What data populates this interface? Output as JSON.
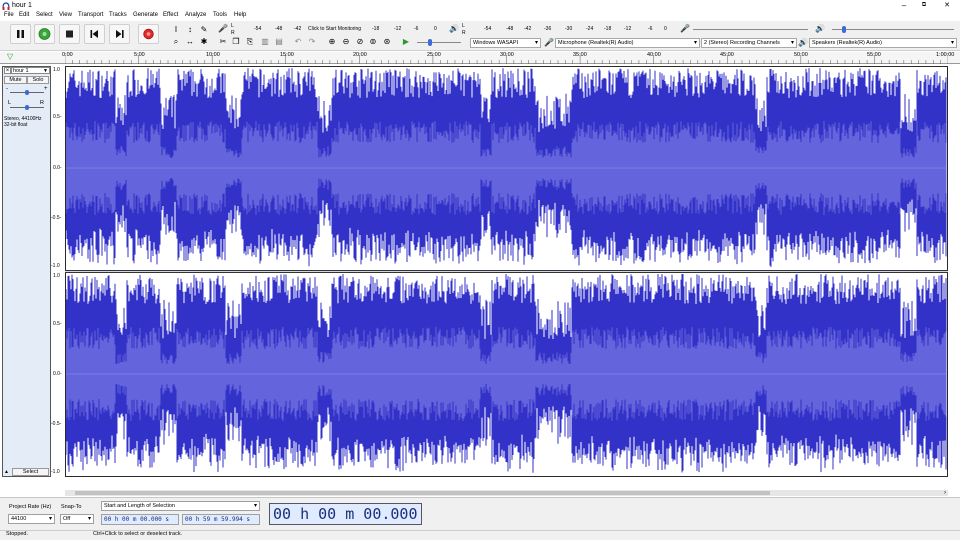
{
  "window": {
    "title": "hour 1",
    "minimize": "–",
    "restore": "⧉",
    "close": "✕"
  },
  "menu": [
    "File",
    "Edit",
    "Select",
    "View",
    "Transport",
    "Tracks",
    "Generate",
    "Effect",
    "Analyze",
    "Tools",
    "Help"
  ],
  "transport": {
    "pause": "pause-icon",
    "play": "play-icon",
    "stop": "stop-icon",
    "skip_start": "skip-start-icon",
    "skip_end": "skip-end-icon",
    "record": "record-icon"
  },
  "meters": {
    "record_ticks": [
      "-54",
      "-48",
      "-42",
      "Click to Start Monitoring",
      "-18",
      "-12",
      "-6",
      "0"
    ],
    "play_ticks": [
      "-54",
      "-48",
      "-42",
      "-36",
      "-30",
      "-24",
      "-18",
      "-12",
      "-6",
      "0"
    ]
  },
  "devices": {
    "host": "Windows WASAPI",
    "mic": "Microphone (Realtek(R) Audio)",
    "channels": "2 (Stereo) Recording Channels",
    "speakers": "Speakers (Realtek(R) Audio)"
  },
  "ruler": [
    "0:00",
    "5:00",
    "10:00",
    "15:00",
    "20:00",
    "25:00",
    "30:00",
    "35:00",
    "40:00",
    "45:00",
    "50:00",
    "55:00",
    "1:00:00"
  ],
  "track": {
    "name": "hour 1",
    "close": "×",
    "collapse": "▼",
    "mute": "Mute",
    "solo": "Solo",
    "pan_left": "L",
    "pan_right": "R",
    "gain_minus": "-",
    "gain_plus": "+",
    "info": "Stereo, 44100Hz\n32-bit float",
    "info_line1": "Stereo, 44100Hz",
    "info_line2": "32-bit float",
    "select": "Select",
    "scale_top": [
      "1.0",
      "0.5-",
      "0.0-",
      "-0.5-",
      "-1.0"
    ],
    "scale_bottom": [
      "1.0",
      "0.5-",
      "0.0-",
      "-0.5-",
      "-1.0"
    ]
  },
  "selection_toolbar": {
    "rate_label": "Project Rate (Hz)",
    "rate_value": "44100",
    "snap_label": "Snap-To",
    "snap_value": "Off",
    "mode": "Start and Length of Selection",
    "start": "00 h 00 m 00.000 s",
    "length": "00 h 59 m 59.994 s",
    "time": "00 h 00 m 00.000 s"
  },
  "status": {
    "left": "Stopped.",
    "hint": "Ctrl+Click to select or deselect track."
  },
  "colors": {
    "wave": "#3232c8",
    "rms": "#6464dc",
    "track_bg": "#ffffff",
    "clip_bg": "#e4ecf7"
  }
}
